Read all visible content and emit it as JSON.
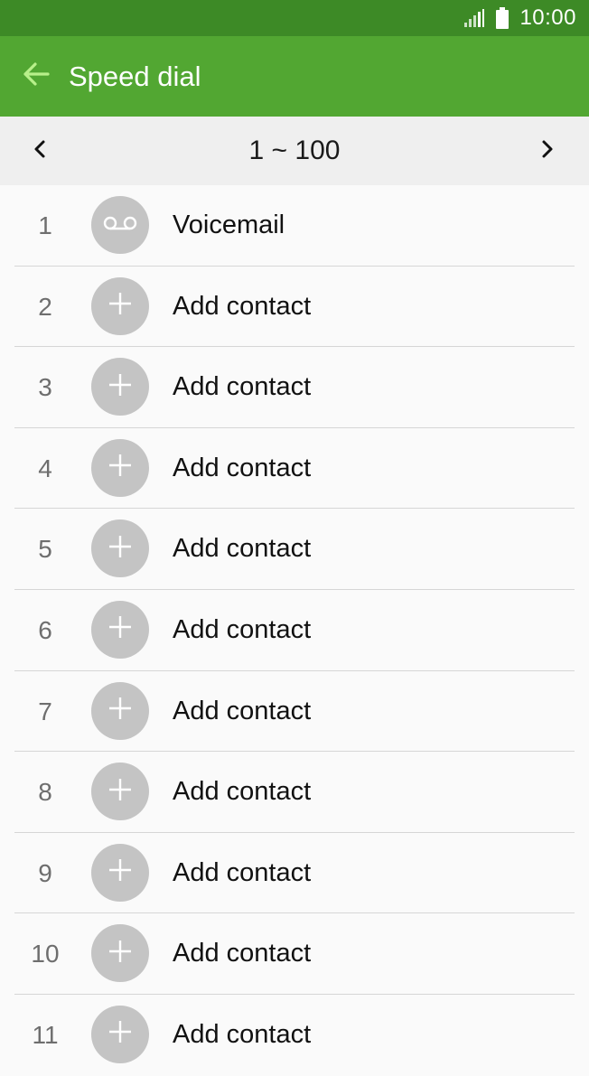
{
  "status_bar": {
    "time": "10:00",
    "icons": [
      "signal-icon",
      "battery-icon"
    ]
  },
  "app_bar": {
    "title": "Speed dial",
    "back_icon": "back-arrow-icon"
  },
  "range": {
    "label": "1 ~ 100",
    "prev_icon": "chevron-left-icon",
    "next_icon": "chevron-right-icon"
  },
  "list": [
    {
      "number": "1",
      "label": "Voicemail",
      "icon": "voicemail-icon"
    },
    {
      "number": "2",
      "label": "Add contact",
      "icon": "plus-icon"
    },
    {
      "number": "3",
      "label": "Add contact",
      "icon": "plus-icon"
    },
    {
      "number": "4",
      "label": "Add contact",
      "icon": "plus-icon"
    },
    {
      "number": "5",
      "label": "Add contact",
      "icon": "plus-icon"
    },
    {
      "number": "6",
      "label": "Add contact",
      "icon": "plus-icon"
    },
    {
      "number": "7",
      "label": "Add contact",
      "icon": "plus-icon"
    },
    {
      "number": "8",
      "label": "Add contact",
      "icon": "plus-icon"
    },
    {
      "number": "9",
      "label": "Add contact",
      "icon": "plus-icon"
    },
    {
      "number": "10",
      "label": "Add contact",
      "icon": "plus-icon"
    },
    {
      "number": "11",
      "label": "Add contact",
      "icon": "plus-icon"
    }
  ],
  "colors": {
    "status_bar": "#3d8a26",
    "app_bar": "#52a732",
    "back_arrow": "#b8f08a",
    "avatar": "#c4c4c4"
  }
}
